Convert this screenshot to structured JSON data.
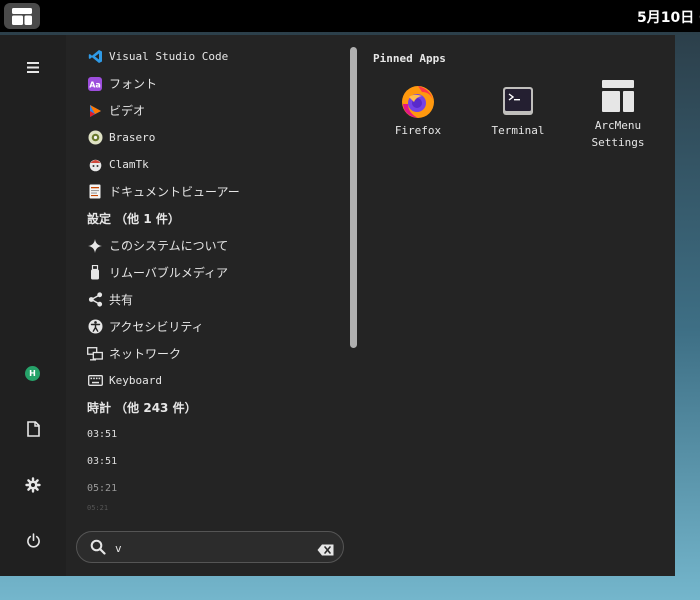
{
  "top_bar": {
    "clock": "5月10日 0"
  },
  "results": [
    {
      "type": "app",
      "label": "Visual Studio Code",
      "icon": "vscode-icon",
      "name": "result-visual-studio-code",
      "mono": true
    },
    {
      "type": "app",
      "label": "フォント",
      "icon": "fonts-icon",
      "name": "result-fonts",
      "mono": false
    },
    {
      "type": "app",
      "label": "ビデオ",
      "icon": "videos-icon",
      "name": "result-videos",
      "mono": false
    },
    {
      "type": "app",
      "label": "Brasero",
      "icon": "brasero-icon",
      "name": "result-brasero",
      "mono": true
    },
    {
      "type": "app",
      "label": "ClamTk",
      "icon": "clamtk-icon",
      "name": "result-clamtk",
      "mono": true
    },
    {
      "type": "app",
      "label": "ドキュメントビューアー",
      "icon": "document-viewer-icon",
      "name": "result-document-viewer",
      "mono": false
    },
    {
      "type": "header",
      "label": "設定 （他 1 件）",
      "name": "settings-category-header"
    },
    {
      "type": "app",
      "label": "このシステムについて",
      "icon": "about-icon",
      "name": "result-about-system",
      "mono": false
    },
    {
      "type": "app",
      "label": "リムーバブルメディア",
      "icon": "removable-media-icon",
      "name": "result-removable-media",
      "mono": false
    },
    {
      "type": "app",
      "label": "共有",
      "icon": "share-icon",
      "name": "result-sharing",
      "mono": false
    },
    {
      "type": "app",
      "label": "アクセシビリティ",
      "icon": "accessibility-icon",
      "name": "result-accessibility",
      "mono": false
    },
    {
      "type": "app",
      "label": "ネットワーク",
      "icon": "network-icon",
      "name": "result-network",
      "mono": false
    },
    {
      "type": "app",
      "label": "Keyboard",
      "icon": "keyboard-icon",
      "name": "result-keyboard",
      "mono": true
    },
    {
      "type": "header",
      "label": "時計 （他 243 件）",
      "name": "clocks-category-header"
    },
    {
      "type": "time",
      "label": "03:51",
      "name": "clock-result",
      "style": "normal"
    },
    {
      "type": "time",
      "label": "03:51",
      "name": "clock-result",
      "style": "normal"
    },
    {
      "type": "time",
      "label": "05:21",
      "name": "clock-result",
      "style": "faded"
    },
    {
      "type": "time",
      "label": "05:21",
      "name": "clock-result",
      "style": "ghost"
    }
  ],
  "search": {
    "value": "v"
  },
  "pinned": {
    "title": "Pinned Apps",
    "apps": [
      {
        "label_lines": [
          "Firefox"
        ],
        "icon": "firefox-icon",
        "name": "pinned-app-firefox"
      },
      {
        "label_lines": [
          "Terminal"
        ],
        "icon": "terminal-icon",
        "name": "pinned-app-terminal"
      },
      {
        "label_lines": [
          "ArcMenu",
          "Settings"
        ],
        "icon": "arcmenu-settings-icon",
        "name": "pinned-app-arcmenu-settings"
      }
    ]
  },
  "sidebar": {
    "avatar_initial": "H"
  }
}
